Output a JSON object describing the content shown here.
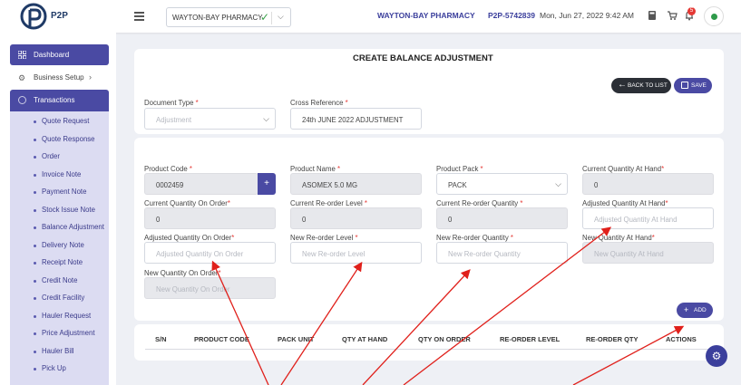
{
  "app": {
    "logo_text": "P2P"
  },
  "topbar": {
    "store_select": {
      "value": "WAYTON-BAY PHARMACY"
    },
    "pharmacy_name": "WAYTON-BAY PHARMACY",
    "account_code": "P2P-5742839",
    "datetime": "Mon, Jun 27, 2022 9:42 AM",
    "notification_count": "5",
    "icons": [
      "menu-icon",
      "calculator-icon",
      "cart-icon",
      "bell-icon",
      "avatar"
    ]
  },
  "sidebar": {
    "dashboard": "Dashboard",
    "business_setup": "Business Setup",
    "transactions": "Transactions",
    "items": [
      "Quote Request",
      "Quote Response",
      "Order",
      "Invoice Note",
      "Payment Note",
      "Stock Issue Note",
      "Balance Adjustment",
      "Delivery Note",
      "Receipt Note",
      "Credit Note",
      "Credit Facility",
      "Hauler Request",
      "Price Adjustment",
      "Hauler Bill",
      "Pick Up"
    ]
  },
  "page": {
    "title": "CREATE BALANCE ADJUSTMENT",
    "back_button": "BACK TO LIST",
    "save_button": "SAVE",
    "add_button": "ADD"
  },
  "header_form": {
    "document_type": {
      "label": "Document Type",
      "placeholder": "Adjustment"
    },
    "cross_reference": {
      "label": "Cross Reference",
      "value": "24th JUNE 2022 ADJUSTMENT"
    }
  },
  "product_form": {
    "product_code": {
      "label": "Product Code",
      "value": "0002459"
    },
    "product_name": {
      "label": "Product Name",
      "value": "ASOMEX 5.0 MG"
    },
    "product_pack": {
      "label": "Product Pack",
      "value": "PACK"
    },
    "current_qty_at_hand": {
      "label": "Current Quantity At Hand",
      "value": "0"
    },
    "current_qty_on_order": {
      "label": "Current Quantity On Order",
      "value": "0"
    },
    "current_reorder_level": {
      "label": "Current Re-order Level",
      "value": "0"
    },
    "current_reorder_qty": {
      "label": "Current Re-order Quantity",
      "value": "0"
    },
    "adjusted_qty_at_hand": {
      "label": "Adjusted Quantity At Hand",
      "placeholder": "Adjusted Quantity At Hand"
    },
    "adjusted_qty_on_order": {
      "label": "Adjusted Quantity On Order",
      "placeholder": "Adjusted Quantity On Order"
    },
    "new_reorder_level": {
      "label": "New Re-order Level",
      "placeholder": "New Re-order Level"
    },
    "new_reorder_qty": {
      "label": "New Re-order Quantity",
      "placeholder": "New Re-order Quantity"
    },
    "new_qty_at_hand": {
      "label": "New Quantity At Hand",
      "placeholder": "New Quantity At Hand"
    },
    "new_qty_on_order": {
      "label": "New Quantity On Order",
      "placeholder": "New Quantity On Order"
    }
  },
  "table": {
    "columns": [
      "S/N",
      "PRODUCT CODE",
      "PACK UNIT",
      "QTY AT HAND",
      "QTY ON ORDER",
      "RE-ORDER LEVEL",
      "RE-ORDER QTY",
      "ACTIONS"
    ]
  },
  "colors": {
    "accent": "#4a4aa3",
    "submenu_bg": "#dcdcf2",
    "annotation_arrow": "#e0201b"
  }
}
